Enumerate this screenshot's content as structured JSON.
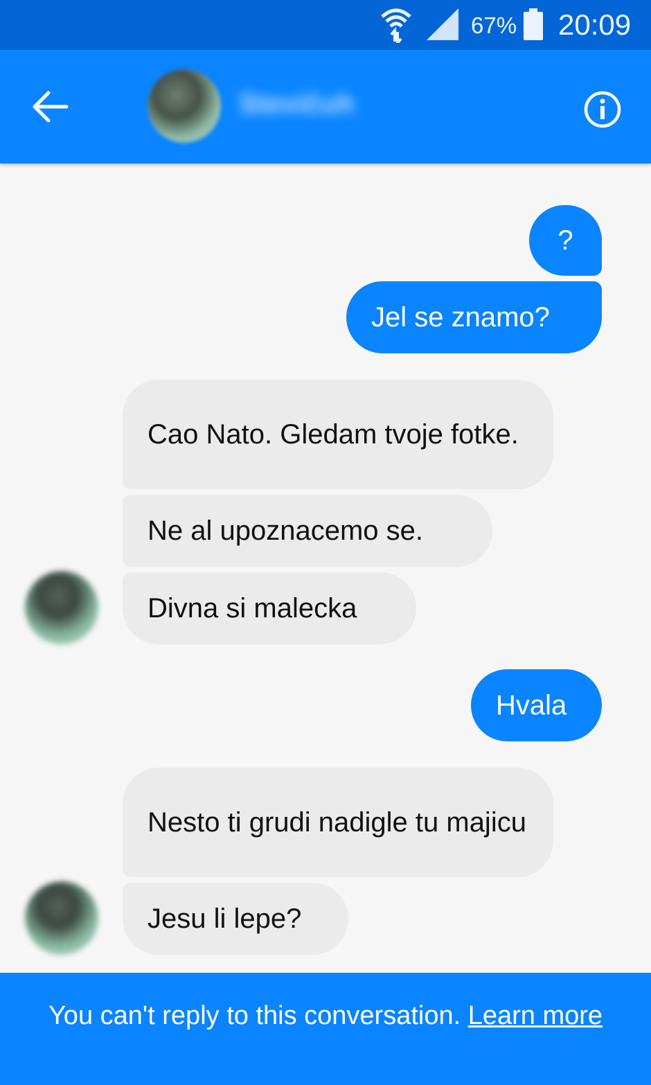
{
  "status_bar": {
    "battery_percent": "67%",
    "time": "20:09",
    "icons": [
      "wifi-data-icon",
      "signal-icon",
      "battery-icon"
    ]
  },
  "header": {
    "contact_name": "Stevičuh",
    "icons": [
      "back-arrow-icon",
      "info-icon"
    ]
  },
  "messages": [
    {
      "direction": "outgoing",
      "text": "?"
    },
    {
      "direction": "outgoing",
      "text": "Jel se znamo?"
    },
    {
      "direction": "incoming",
      "text": "Cao Nato. Gledam tvoje fotke."
    },
    {
      "direction": "incoming",
      "text": "Ne al upoznacemo se."
    },
    {
      "direction": "incoming",
      "text": "Divna si malecka"
    },
    {
      "direction": "outgoing",
      "text": "Hvala"
    },
    {
      "direction": "incoming",
      "text": "Nesto ti grudi nadigle tu majicu"
    },
    {
      "direction": "incoming",
      "text": "Jesu li lepe?"
    }
  ],
  "footer": {
    "notice": "You can't reply to this conversation.",
    "link": "Learn more"
  },
  "colors": {
    "status_bar": "#0466d6",
    "brand_blue": "#0a84ff",
    "incoming_bubble": "#ebebeb",
    "background": "#f6f6f6"
  }
}
